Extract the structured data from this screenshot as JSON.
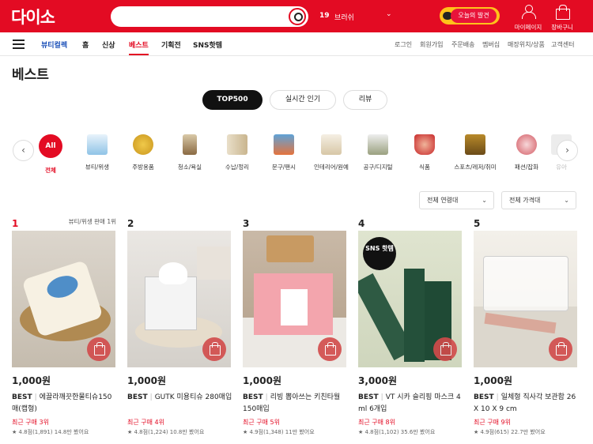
{
  "header": {
    "logo": "다이소",
    "trend_rank": "19",
    "trend_word": "브러쉬",
    "promo_label": "오늘의 발견",
    "mypage_label": "마이페이지",
    "cart_label": "장바구니"
  },
  "nav": {
    "beauty_label": "뷰티컬렉",
    "items": [
      "홈",
      "신상",
      "베스트",
      "기획전",
      "SNS핫템"
    ],
    "active": "베스트",
    "util": [
      "로그인",
      "회원가입",
      "주문배송",
      "멤버십",
      "매장위치/상품",
      "고객센터"
    ]
  },
  "page": {
    "title": "베스트"
  },
  "tabs": [
    "TOP500",
    "실시간 인기",
    "리뷰"
  ],
  "active_tab": "TOP500",
  "categories": [
    {
      "label": "전체",
      "badge": "All"
    },
    {
      "label": "뷰티/위생"
    },
    {
      "label": "주방용품"
    },
    {
      "label": "청소/욕실"
    },
    {
      "label": "수납/정리"
    },
    {
      "label": "문구/팬시"
    },
    {
      "label": "인테리어/원예"
    },
    {
      "label": "공구/디지털"
    },
    {
      "label": "식품"
    },
    {
      "label": "스포츠/레저/취미"
    },
    {
      "label": "패션/잡화"
    },
    {
      "label": "유아"
    }
  ],
  "filters": {
    "age": "전체 연령대",
    "price": "전체 가격대"
  },
  "products": [
    {
      "rank": "1",
      "category_rank": "뷰티/위생 판매 1위",
      "price": "1,000원",
      "badge": "BEST",
      "name": "에끌라깨끗한물티슈150매(캡형)",
      "recent": "최근 구매 3위",
      "rating": "★ 4.8점(1,891)  14.8만 봤어요"
    },
    {
      "rank": "2",
      "category_rank": "",
      "price": "1,000원",
      "badge": "BEST",
      "name": "GUTK 미용티슈 280매입",
      "recent": "최근 구매 4위",
      "rating": "★ 4.8점(1,224)  10.8만 봤어요"
    },
    {
      "rank": "3",
      "category_rank": "",
      "price": "1,000원",
      "badge": "BEST",
      "name": "리빙 뽑아쓰는 키친타월 150매입",
      "recent": "최근 구매 5위",
      "rating": "★ 4.9점(1,348)  11만 봤어요"
    },
    {
      "rank": "4",
      "category_rank": "",
      "price": "3,000원",
      "badge": "BEST",
      "name": "VT 시카 슬리핑 마스크 4 ml 6개입",
      "recent": "최근 구매 8위",
      "rating": "★ 4.8점(1,102)  35.6만 봤어요",
      "image_badge": "SNS 핫템"
    },
    {
      "rank": "5",
      "category_rank": "",
      "price": "1,000원",
      "badge": "BEST",
      "name": "일체형 직사각 보관함 26 X 10 X 9 cm",
      "recent": "최근 구매 9위",
      "rating": "★ 4.9점(615)  22.7만 봤어요"
    }
  ],
  "colors": {
    "brand": "#e30b23",
    "dark": "#111111"
  }
}
